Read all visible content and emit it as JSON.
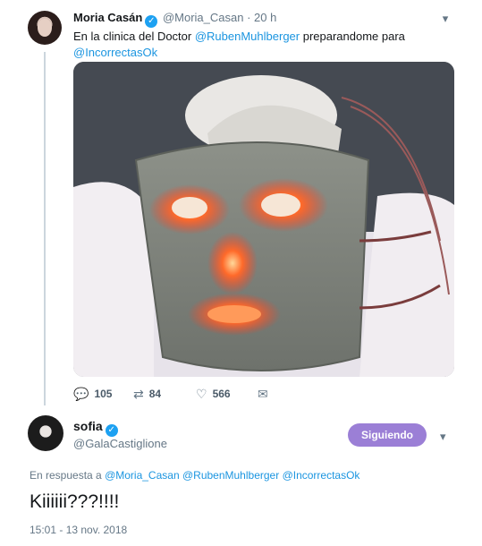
{
  "tweet1": {
    "name": "Moria Casán",
    "handle": "@Moria_Casan",
    "sep": "·",
    "time": "20 h",
    "text_prefix": "En la clinica del Doctor ",
    "mention1": "@RubenMuhlberger",
    "text_mid": " preparandome para ",
    "mention2": "@IncorrectasOk",
    "emoji": "💋",
    "replies": "105",
    "retweets": "84",
    "likes": "566"
  },
  "tweet2": {
    "name": "sofia",
    "handle": "@GalaCastiglione",
    "follow_label": "Siguiendo",
    "reply_prefix": "En respuesta a ",
    "reply_m1": "@Moria_Casan",
    "reply_m2": "@RubenMuhlberger",
    "reply_m3": "@IncorrectasOk",
    "text": "Kiiiiii???!!!!",
    "timestamp": "15:01 - 13 nov. 2018"
  },
  "icons": {
    "reply": "reply-icon",
    "retweet": "retweet-icon",
    "like": "heart-icon",
    "dm": "envelope-icon",
    "caret": "chevron-down-icon",
    "verified": "verified-badge-icon"
  },
  "colors": {
    "link": "#1b95e0",
    "verified": "#1da1f2",
    "follow_button": "#9b7fd6",
    "muted": "#657786"
  }
}
